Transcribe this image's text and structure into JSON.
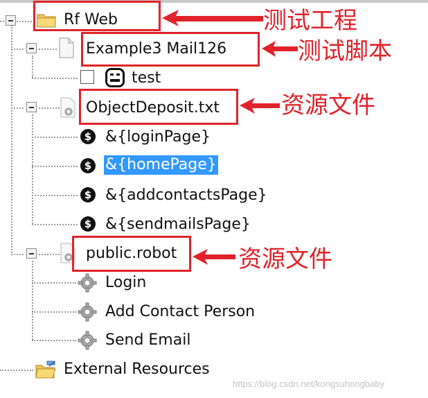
{
  "tree": {
    "root": {
      "label": "Rf Web",
      "icon": "folder-icon"
    },
    "suite_file": {
      "label": "Example3 Mail126",
      "icon": "file-icon"
    },
    "test_case": {
      "label": "test",
      "icon": "robot-test-icon"
    },
    "resource_txt": {
      "label": "ObjectDeposit.txt",
      "icon": "gear-file-icon",
      "variables": [
        {
          "label": "&{loginPage}",
          "selected": false
        },
        {
          "label": "&{homePage}",
          "selected": true
        },
        {
          "label": "&{addcontactsPage}",
          "selected": false
        },
        {
          "label": "&{sendmailsPage}",
          "selected": false
        }
      ]
    },
    "resource_robot": {
      "label": "public.robot",
      "icon": "gear-file-icon",
      "keywords": [
        "Login",
        "Add Contact Person",
        "Send Email"
      ]
    },
    "external": {
      "label": "External Resources",
      "icon": "external-folder-icon"
    }
  },
  "annotations": {
    "project": "测试工程",
    "script": "测试脚本",
    "resource1": "资源文件",
    "resource2": "资源文件"
  },
  "watermark": "https://blog.csdn.net/kongsuhongbaby",
  "colors": {
    "annotation_red": "#e0232b",
    "selection_blue": "#3399ff"
  }
}
